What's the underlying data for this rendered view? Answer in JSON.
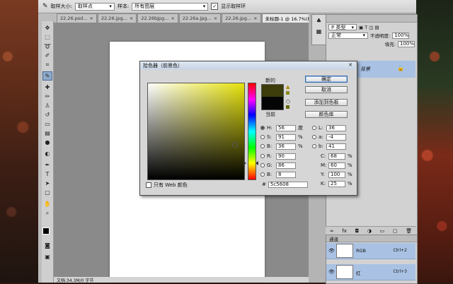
{
  "options_bar": {
    "sample_size_label": "取样大小:",
    "sample_size_value": "取样点",
    "sample_label": "样本:",
    "sample_value": "所有图层",
    "show_ring_label": "显示取样环",
    "show_ring_checked": "✓"
  },
  "tabs": [
    {
      "label": "22.26.psd...",
      "close": "×"
    },
    {
      "label": "22.26.jpg...",
      "close": "×"
    },
    {
      "label": "22.26bjpg...",
      "close": "×"
    },
    {
      "label": "22.26a.jpg...",
      "close": "×"
    },
    {
      "label": "22.26.jpg...",
      "close": "×"
    },
    {
      "label": "未标题-1 @ 16.7%(RGB/8)",
      "close": "×"
    }
  ],
  "toolbar": {
    "tools": [
      "move-tool",
      "marquee-tool",
      "lasso-tool",
      "quick-select-tool",
      "crop-tool",
      "eyedropper-tool",
      "healing-tool",
      "brush-tool",
      "stamp-tool",
      "history-brush-tool",
      "eraser-tool",
      "gradient-tool",
      "blur-tool",
      "dodge-tool",
      "pen-tool",
      "type-tool",
      "path-select-tool",
      "shape-tool",
      "hand-tool",
      "zoom-tool"
    ],
    "active_index": 5
  },
  "status_bar": {
    "text": "文档:34.3M/0 字节"
  },
  "layers_panel": {
    "blend_mode": "正常",
    "opacity_label": "不透明度:",
    "opacity_value": "100%",
    "fill_label": "填充:",
    "fill_value": "100%",
    "kind_label": "P 类型",
    "layer_name": "背景"
  },
  "channels_panel": {
    "title": "通道",
    "rows": [
      {
        "name": "RGB",
        "shortcut": "Ctrl+2"
      },
      {
        "name": "红",
        "shortcut": "Ctrl+3"
      }
    ]
  },
  "color_picker": {
    "title": "拾色器（前景色）",
    "new_label": "新的",
    "current_label": "当前",
    "buttons": {
      "ok": "确定",
      "cancel": "取消",
      "add_swatch": "添加到色板",
      "libraries": "颜色库"
    },
    "hsb": [
      {
        "label": "H:",
        "value": "56",
        "unit": "度",
        "selected": true
      },
      {
        "label": "S:",
        "value": "91",
        "unit": "%",
        "selected": false
      },
      {
        "label": "B:",
        "value": "36",
        "unit": "%",
        "selected": false
      }
    ],
    "rgb": [
      {
        "label": "R:",
        "value": "90",
        "unit": "",
        "selected": false
      },
      {
        "label": "G:",
        "value": "86",
        "unit": "",
        "selected": false
      },
      {
        "label": "B:",
        "value": "8",
        "unit": "",
        "selected": false
      }
    ],
    "lab": [
      {
        "label": "L:",
        "value": "36"
      },
      {
        "label": "a:",
        "value": "-4"
      },
      {
        "label": "b:",
        "value": "41"
      }
    ],
    "cmyk": [
      {
        "label": "C:",
        "value": "68",
        "unit": "%"
      },
      {
        "label": "M:",
        "value": "60",
        "unit": "%"
      },
      {
        "label": "Y:",
        "value": "100",
        "unit": "%"
      },
      {
        "label": "K:",
        "value": "25",
        "unit": "%"
      }
    ],
    "hex_label": "#",
    "hex_value": "5c5608",
    "web_only_label": "只有 Web 颜色",
    "new_color": "#3c3c0a",
    "current_color": "#050505",
    "field_hue_color": "#e6e20a"
  }
}
